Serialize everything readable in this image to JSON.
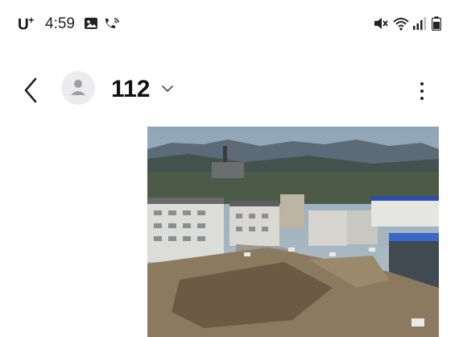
{
  "status_bar": {
    "carrier": "U",
    "carrier_sup": "+",
    "time": "4:59",
    "icons": [
      "gallery-notification-icon",
      "wifi-calling-icon",
      "mute-icon",
      "wifi-icon",
      "signal-icon",
      "battery-icon"
    ]
  },
  "header": {
    "contact": "112",
    "icons": [
      "back-arrow-icon",
      "avatar-icon",
      "chevron-down-icon",
      "more-options-icon"
    ]
  },
  "message": {
    "type": "image",
    "description_icon": "photo-attachment"
  },
  "colors": {
    "background": "#ffffff",
    "text": "#111111",
    "avatar_bg": "#ececef"
  }
}
